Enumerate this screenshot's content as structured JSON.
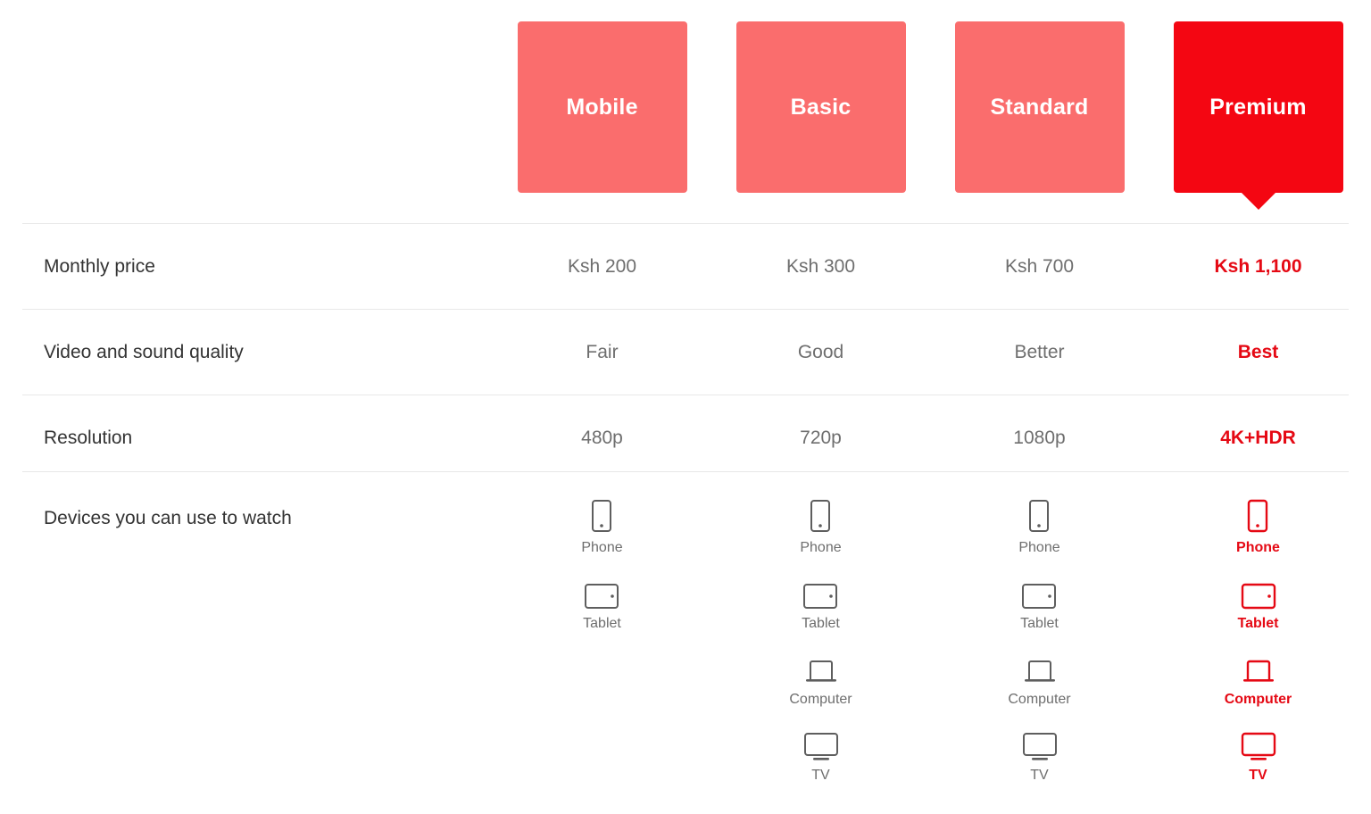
{
  "colors": {
    "tier_normal": "#FA6D6D",
    "tier_featured": "#F40612",
    "accent_text": "#E50914",
    "label_text": "#333333",
    "value_text": "#6E6E6E",
    "divider": "#E8E8E8",
    "background": "#FFFFFF"
  },
  "plans": [
    {
      "name": "Mobile",
      "featured": false
    },
    {
      "name": "Basic",
      "featured": false
    },
    {
      "name": "Standard",
      "featured": false
    },
    {
      "name": "Premium",
      "featured": true
    }
  ],
  "rows": {
    "price": {
      "label": "Monthly price",
      "values": [
        "Ksh 200",
        "Ksh 300",
        "Ksh 700",
        "Ksh 1,100"
      ]
    },
    "quality": {
      "label": "Video and sound quality",
      "values": [
        "Fair",
        "Good",
        "Better",
        "Best"
      ]
    },
    "resolution": {
      "label": "Resolution",
      "values": [
        "480p",
        "720p",
        "1080p",
        "4K+HDR"
      ]
    },
    "devices": {
      "label": "Devices you can use to watch",
      "columns": [
        {
          "items": [
            {
              "icon": "phone-icon",
              "label": "Phone"
            },
            {
              "icon": "tablet-icon",
              "label": "Tablet"
            }
          ]
        },
        {
          "items": [
            {
              "icon": "phone-icon",
              "label": "Phone"
            },
            {
              "icon": "tablet-icon",
              "label": "Tablet"
            },
            {
              "icon": "computer-icon",
              "label": "Computer"
            },
            {
              "icon": "tv-icon",
              "label": "TV"
            }
          ]
        },
        {
          "items": [
            {
              "icon": "phone-icon",
              "label": "Phone"
            },
            {
              "icon": "tablet-icon",
              "label": "Tablet"
            },
            {
              "icon": "computer-icon",
              "label": "Computer"
            },
            {
              "icon": "tv-icon",
              "label": "TV"
            }
          ]
        },
        {
          "items": [
            {
              "icon": "phone-icon",
              "label": "Phone"
            },
            {
              "icon": "tablet-icon",
              "label": "Tablet"
            },
            {
              "icon": "computer-icon",
              "label": "Computer"
            },
            {
              "icon": "tv-icon",
              "label": "TV"
            }
          ]
        }
      ]
    }
  }
}
